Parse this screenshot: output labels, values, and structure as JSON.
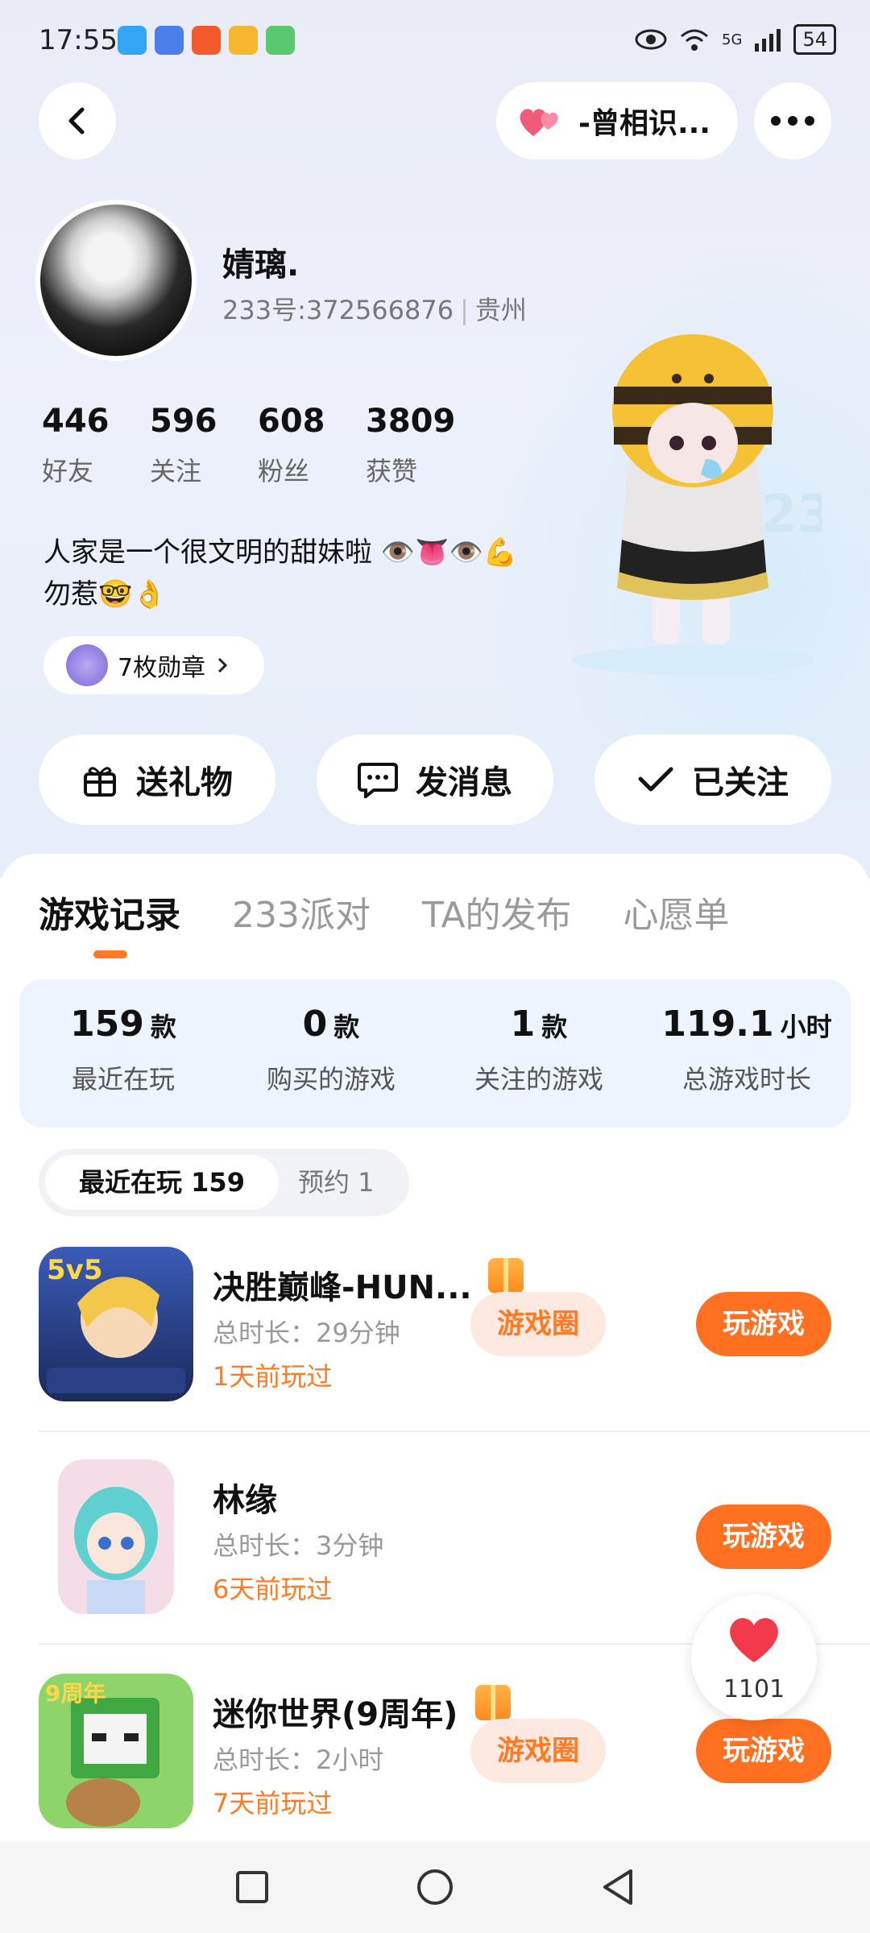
{
  "status": {
    "time": "17:55",
    "network": "5G",
    "battery": "54",
    "apps": [
      "#34a4f5",
      "#4a7ee8",
      "#f25a2d",
      "#f5b72d",
      "#59c86e"
    ]
  },
  "header": {
    "back_icon": "chevron-left-icon",
    "relation_label": "-曾相识...",
    "more_icon": "more-dots-icon"
  },
  "profile": {
    "name": "婧璃.",
    "id_label": "233号:372566876",
    "location": "贵州",
    "stats": [
      {
        "num": "446",
        "label": "好友"
      },
      {
        "num": "596",
        "label": "关注"
      },
      {
        "num": "608",
        "label": "粉丝"
      },
      {
        "num": "3809",
        "label": "获赞"
      }
    ],
    "bio_line1": "人家是一个很文明的甜妹啦 👁️👅👁️💪",
    "bio_line2": "勿惹🤓👌",
    "medal_label": "7枚勋章"
  },
  "actions": {
    "gift": "送礼物",
    "message": "发消息",
    "follow": "已关注"
  },
  "tabs": [
    "游戏记录",
    "233派对",
    "TA的发布",
    "心愿单"
  ],
  "summary": [
    {
      "value": "159",
      "unit": "款",
      "label": "最近在玩"
    },
    {
      "value": "0",
      "unit": "款",
      "label": "购买的游戏"
    },
    {
      "value": "1",
      "unit": "款",
      "label": "关注的游戏"
    },
    {
      "value": "119.1",
      "unit": "小时",
      "label": "总游戏时长"
    }
  ],
  "filter": {
    "recent": "最近在玩 159",
    "reserve": "预约 1"
  },
  "games": [
    {
      "title": "决胜巅峰-HUN...",
      "duration": "总时长：29分钟",
      "last": "1天前玩过",
      "circle": "游戏圈",
      "play": "玩游戏"
    },
    {
      "title": "林缘",
      "duration": "总时长：3分钟",
      "last": "6天前玩过",
      "play": "玩游戏"
    },
    {
      "title": "迷你世界(9周年)",
      "duration": "总时长：2小时",
      "last": "7天前玩过",
      "circle": "游戏圈",
      "play": "玩游戏"
    }
  ],
  "like_count": "1101",
  "colors": {
    "accent": "#ff7020",
    "card_bg": "#eef4fd"
  }
}
